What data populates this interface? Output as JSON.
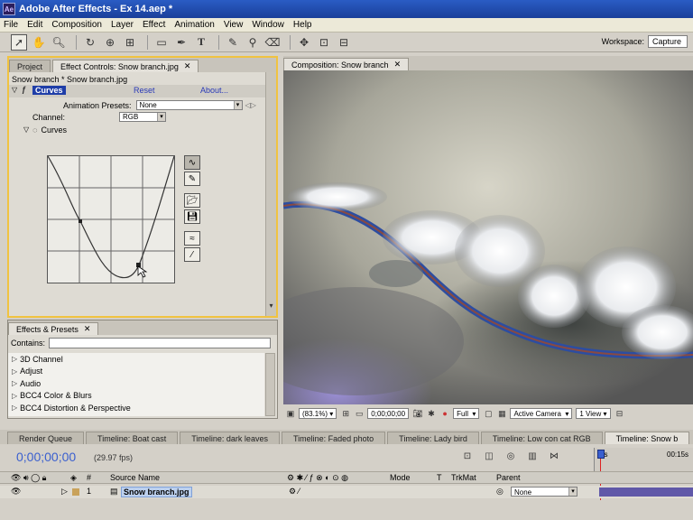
{
  "app": {
    "title": "Adobe After Effects - Ex 14.aep *"
  },
  "menu": [
    "File",
    "Edit",
    "Composition",
    "Layer",
    "Effect",
    "Animation",
    "View",
    "Window",
    "Help"
  ],
  "toolbar": {
    "workspace_label": "Workspace:",
    "workspace_value": "Capture"
  },
  "left_panel": {
    "tabs": [
      "Project",
      "Effect Controls: Snow branch.jpg"
    ],
    "breadcrumb": "Snow branch * Snow branch.jpg",
    "effect": {
      "name": "Curves",
      "reset": "Reset",
      "about": "About...",
      "animation_presets_label": "Animation Presets:",
      "animation_presets_value": "None",
      "channel_label": "Channel:",
      "channel_value": "RGB",
      "curves_label": "Curves"
    }
  },
  "presets_panel": {
    "tab": "Effects & Presets",
    "contains_label": "Contains:",
    "items": [
      "3D Channel",
      "Adjust",
      "Audio",
      "BCC4 Color & Blurs",
      "BCC4 Distortion & Perspective"
    ]
  },
  "composition": {
    "tab": "Composition: Snow branch",
    "zoom": "(83.1%)",
    "timecode": "0;00;00;00",
    "resolution": "Full",
    "camera": "Active Camera",
    "views": "1 View"
  },
  "timeline": {
    "tabs": [
      "Render Queue",
      "Timeline: Boat cast",
      "Timeline: dark leaves",
      "Timeline: Faded photo",
      "Timeline: Lady bird",
      "Timeline: Low con cat RGB",
      "Timeline: Snow b"
    ],
    "timecode": "0;00;00;00",
    "fps": "(29.97 fps)",
    "ruler_start": "0s",
    "ruler_mark": "00:15s",
    "columns": {
      "num": "#",
      "source_name": "Source Name",
      "mode": "Mode",
      "t": "T",
      "trkmat": "TrkMat",
      "parent": "Parent"
    },
    "layer": {
      "index": "1",
      "name": "Snow branch.jpg",
      "parent": "None"
    }
  }
}
